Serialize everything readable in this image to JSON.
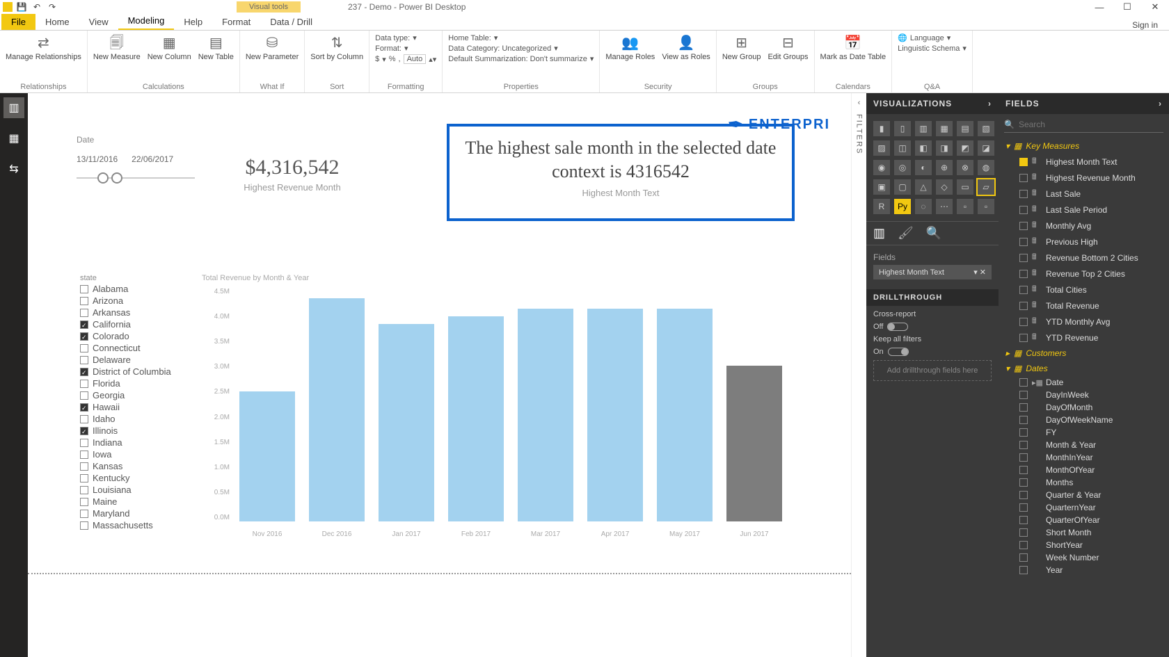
{
  "app": {
    "title": "237 - Demo - Power BI Desktop",
    "visual_tools": "Visual tools",
    "signin": "Sign in"
  },
  "qat": {
    "save": "💾",
    "undo": "↶",
    "redo": "↷"
  },
  "winctl": {
    "min": "—",
    "max": "☐",
    "close": "✕"
  },
  "tabs": {
    "file": "File",
    "home": "Home",
    "view": "View",
    "modeling": "Modeling",
    "help": "Help",
    "format": "Format",
    "datadrill": "Data / Drill"
  },
  "ribbon": {
    "relationships": {
      "manage": "Manage\nRelationships",
      "group": "Relationships"
    },
    "calc": {
      "measure": "New\nMeasure",
      "column": "New\nColumn",
      "table": "New\nTable",
      "group": "Calculations"
    },
    "whatif": {
      "param": "New\nParameter",
      "group": "What If"
    },
    "sort": {
      "sort": "Sort by\nColumn",
      "group": "Sort"
    },
    "formatting": {
      "datatype": "Data type:",
      "format": "Format:",
      "curr": "$",
      "pct": "%",
      "comma": ",",
      "auto": "Auto",
      "hometable": "Home Table:",
      "datacat": "Data Category: Uncategorized",
      "summ": "Default Summarization: Don't summarize",
      "group": "Formatting",
      "propgroup": "Properties"
    },
    "security": {
      "manage": "Manage\nRoles",
      "viewas": "View as\nRoles",
      "group": "Security"
    },
    "groups": {
      "new": "New\nGroup",
      "edit": "Edit\nGroups",
      "group": "Groups"
    },
    "calendars": {
      "mark": "Mark as\nDate Table",
      "group": "Calendars"
    },
    "qa": {
      "lang": "Language",
      "ling": "Linguistic Schema",
      "group": "Q&A"
    }
  },
  "date_card": {
    "label": "Date",
    "from": "13/11/2016",
    "to": "22/06/2017"
  },
  "kpi": {
    "value": "$4,316,542",
    "label": "Highest Revenue Month"
  },
  "textcard": {
    "text": "The highest sale month in the selected date context is 4316542",
    "label": "Highest Month Text"
  },
  "logo": "ENTERPRI",
  "slicer": {
    "label": "state",
    "items": [
      {
        "n": "Alabama",
        "c": false
      },
      {
        "n": "Arizona",
        "c": false
      },
      {
        "n": "Arkansas",
        "c": false
      },
      {
        "n": "California",
        "c": true
      },
      {
        "n": "Colorado",
        "c": true
      },
      {
        "n": "Connecticut",
        "c": false
      },
      {
        "n": "Delaware",
        "c": false
      },
      {
        "n": "District of Columbia",
        "c": true
      },
      {
        "n": "Florida",
        "c": false
      },
      {
        "n": "Georgia",
        "c": false
      },
      {
        "n": "Hawaii",
        "c": true
      },
      {
        "n": "Idaho",
        "c": false
      },
      {
        "n": "Illinois",
        "c": true
      },
      {
        "n": "Indiana",
        "c": false
      },
      {
        "n": "Iowa",
        "c": false
      },
      {
        "n": "Kansas",
        "c": false
      },
      {
        "n": "Kentucky",
        "c": false
      },
      {
        "n": "Louisiana",
        "c": false
      },
      {
        "n": "Maine",
        "c": false
      },
      {
        "n": "Maryland",
        "c": false
      },
      {
        "n": "Massachusetts",
        "c": false
      }
    ]
  },
  "chart_data": {
    "type": "bar",
    "title": "Total Revenue by Month & Year",
    "categories": [
      "Nov 2016",
      "Dec 2016",
      "Jan 2017",
      "Feb 2017",
      "Mar 2017",
      "Apr 2017",
      "May 2017",
      "Jun 2017"
    ],
    "values": [
      2.5,
      4.3,
      3.8,
      3.95,
      4.1,
      4.1,
      4.1,
      3.0
    ],
    "ylabels": [
      "4.5M",
      "4.0M",
      "3.5M",
      "3.0M",
      "2.5M",
      "2.0M",
      "1.5M",
      "1.0M",
      "0.5M",
      "0.0M"
    ],
    "ylim": [
      0,
      4.5
    ],
    "highlight_index": 7
  },
  "filters": {
    "label": "FILTERS"
  },
  "viz": {
    "header": "VISUALIZATIONS",
    "fields_label": "Fields",
    "field_chip": "Highest Month Text",
    "drill": {
      "header": "DRILLTHROUGH",
      "cross": "Cross-report",
      "cross_state": "Off",
      "keep": "Keep all filters",
      "keep_state": "On",
      "drop": "Add drillthrough fields here"
    }
  },
  "fields": {
    "header": "FIELDS",
    "search": "Search",
    "tables": [
      {
        "name": "Key Measures",
        "open": true,
        "fields": [
          {
            "n": "Highest Month Text",
            "c": true,
            "t": "measure"
          },
          {
            "n": "Highest Revenue Month",
            "c": false,
            "t": "measure"
          },
          {
            "n": "Last Sale",
            "c": false,
            "t": "measure"
          },
          {
            "n": "Last Sale Period",
            "c": false,
            "t": "measure"
          },
          {
            "n": "Monthly Avg",
            "c": false,
            "t": "measure"
          },
          {
            "n": "Previous High",
            "c": false,
            "t": "measure"
          },
          {
            "n": "Revenue Bottom 2 Cities",
            "c": false,
            "t": "measure"
          },
          {
            "n": "Revenue Top 2 Cities",
            "c": false,
            "t": "measure"
          },
          {
            "n": "Total Cities",
            "c": false,
            "t": "measure"
          },
          {
            "n": "Total Revenue",
            "c": false,
            "t": "measure"
          },
          {
            "n": "YTD Monthly Avg",
            "c": false,
            "t": "measure"
          },
          {
            "n": "YTD Revenue",
            "c": false,
            "t": "measure"
          }
        ]
      },
      {
        "name": "Customers",
        "open": false,
        "fields": []
      },
      {
        "name": "Dates",
        "open": true,
        "fields": [
          {
            "n": "Date",
            "c": false,
            "t": "hier"
          },
          {
            "n": "DayInWeek",
            "c": false,
            "t": "col"
          },
          {
            "n": "DayOfMonth",
            "c": false,
            "t": "col"
          },
          {
            "n": "DayOfWeekName",
            "c": false,
            "t": "col"
          },
          {
            "n": "FY",
            "c": false,
            "t": "col"
          },
          {
            "n": "Month & Year",
            "c": false,
            "t": "col"
          },
          {
            "n": "MonthInYear",
            "c": false,
            "t": "col"
          },
          {
            "n": "MonthOfYear",
            "c": false,
            "t": "col"
          },
          {
            "n": "Months",
            "c": false,
            "t": "col"
          },
          {
            "n": "Quarter & Year",
            "c": false,
            "t": "col"
          },
          {
            "n": "QuarternYear",
            "c": false,
            "t": "col"
          },
          {
            "n": "QuarterOfYear",
            "c": false,
            "t": "col"
          },
          {
            "n": "Short Month",
            "c": false,
            "t": "col"
          },
          {
            "n": "ShortYear",
            "c": false,
            "t": "col"
          },
          {
            "n": "Week Number",
            "c": false,
            "t": "col"
          },
          {
            "n": "Year",
            "c": false,
            "t": "col"
          }
        ]
      }
    ]
  }
}
